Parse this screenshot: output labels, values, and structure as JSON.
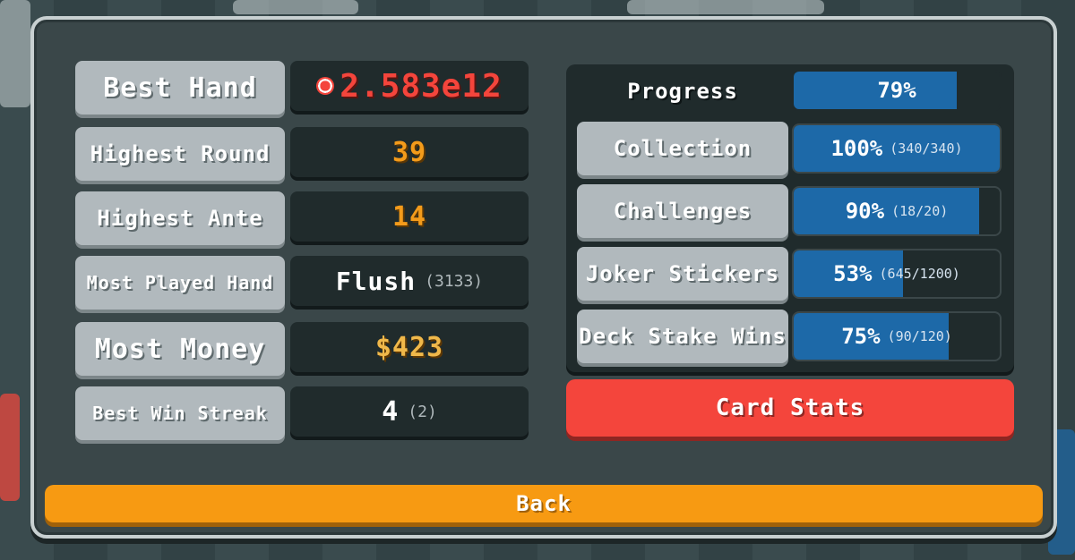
{
  "stats": {
    "best_hand": {
      "label": "Best Hand",
      "value": "2.583e12"
    },
    "highest_round": {
      "label": "Highest Round",
      "value": "39"
    },
    "highest_ante": {
      "label": "Highest Ante",
      "value": "14"
    },
    "most_played_hand": {
      "label": "Most Played Hand",
      "value": "Flush",
      "count": "(3133)"
    },
    "most_money": {
      "label": "Most Money",
      "value": "$423"
    },
    "best_win_streak": {
      "label": "Best Win Streak",
      "value": "4",
      "current": "(2)"
    }
  },
  "progress": {
    "title": "Progress",
    "overall": {
      "percent_text": "79%",
      "fill": 0.79
    },
    "items": [
      {
        "label": "Collection",
        "percent_text": "100%",
        "detail": "(340/340)",
        "fill": 1.0
      },
      {
        "label": "Challenges",
        "percent_text": "90%",
        "detail": "(18/20)",
        "fill": 0.9
      },
      {
        "label": "Joker Stickers",
        "percent_text": "53%",
        "detail": "(645/1200)",
        "fill": 0.53
      },
      {
        "label": "Deck Stake Wins",
        "percent_text": "75%",
        "detail": "(90/120)",
        "fill": 0.75
      }
    ]
  },
  "buttons": {
    "card_stats": "Card Stats",
    "back": "Back"
  },
  "icons": {
    "best_hand": "chip-icon"
  },
  "colors": {
    "red": "#f4453c",
    "orange": "#f39b1b",
    "blue": "#1d69a8",
    "back": "#f79a12"
  }
}
